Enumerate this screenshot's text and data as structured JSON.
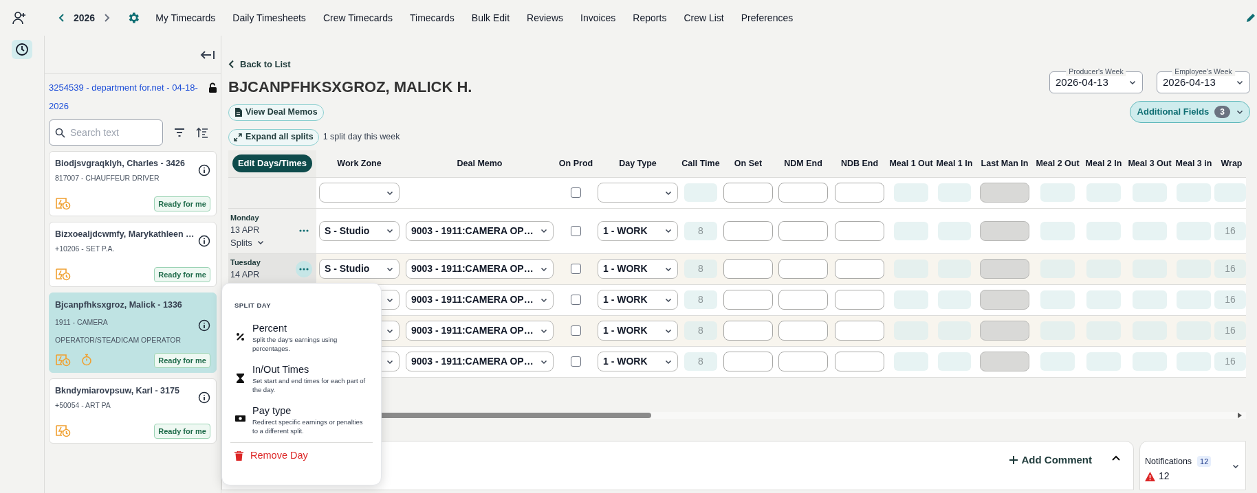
{
  "top_nav": {
    "year": "2026",
    "items": [
      "My Timecards",
      "Daily Timesheets",
      "Crew Timecards",
      "Timecards",
      "Bulk Edit",
      "Reviews",
      "Invoices",
      "Reports",
      "Crew List",
      "Preferences"
    ]
  },
  "employee_panel": {
    "batch_link": "3254539 - department for.net - 04-18-2026",
    "search": {
      "placeholder": "Search text"
    },
    "cards": [
      {
        "name": "Biodjsvgraqklyh, Charles - 3426",
        "lines": [
          "817007 - CHAUFFEUR DRIVER"
        ],
        "status": "Ready for me",
        "selected": false,
        "timer": false
      },
      {
        "name": "Bizxoealjdcwmfy, Marykathleen …",
        "lines": [
          "+10206 - SET P.A."
        ],
        "status": "Ready for me",
        "selected": false,
        "timer": false
      },
      {
        "name": "Bjcanpfhksxgroz, Malick - 1336",
        "lines": [
          "1911 - CAMERA",
          "OPERATOR/STEADICAM OPERATOR"
        ],
        "status": "Ready for me",
        "selected": true,
        "timer": true
      },
      {
        "name": "Bkndymiarovpsuw, Karl - 3175",
        "lines": [
          "+50054 - ART PA"
        ],
        "status": "Ready for me",
        "selected": false,
        "timer": false
      }
    ]
  },
  "timecard": {
    "back": "Back to List",
    "title": "BJCANPFHKSXGROZ, MALICK H.",
    "view_deal_memos": "View Deal Memos",
    "expand_splits": "Expand all splits",
    "split_note": "1 split day this week",
    "producers_week": {
      "label": "Producer's Week",
      "value": "2026-04-13"
    },
    "employees_week": {
      "label": "Employee's Week",
      "value": "2026-04-13"
    },
    "additional_fields": {
      "label": "Additional Fields",
      "count": "3"
    }
  },
  "table": {
    "edit_button": "Edit Days/Times",
    "columns": [
      "Work Zone",
      "Deal Memo",
      "On Prod",
      "Day Type",
      "Call Time",
      "On Set",
      "NDM End",
      "NDB End",
      "Meal 1 Out",
      "Meal 1 In",
      "Last Man In",
      "Meal 2 Out",
      "Meal 2 In",
      "Meal 3 Out",
      "Meal 3 in",
      "Wrap"
    ],
    "rows": [
      {
        "kind": "filter",
        "on_prod": false
      },
      {
        "kind": "day",
        "day": "Monday",
        "date": "13 APR",
        "splits": "Splits",
        "work_zone": "S - Studio",
        "deal_memo": "9003 - 1911:CAMERA OP…",
        "on_prod": false,
        "day_type": "1 - WORK",
        "call_time": "8",
        "wrap": "16",
        "shaded": false,
        "menu_open": false
      },
      {
        "kind": "day",
        "day": "Tuesday",
        "date": "14 APR",
        "work_zone": "S - Studio",
        "deal_memo": "9003 - 1911:CAMERA OP…",
        "on_prod": false,
        "day_type": "1 - WORK",
        "call_time": "8",
        "wrap": "16",
        "shaded": true,
        "menu_open": true
      },
      {
        "kind": "day",
        "deal_memo": "9003 - 1911:CAMERA OP…",
        "on_prod": false,
        "day_type": "1 - WORK",
        "call_time": "8",
        "wrap": "16",
        "shaded": false
      },
      {
        "kind": "day",
        "deal_memo": "9003 - 1911:CAMERA OP…",
        "on_prod": false,
        "day_type": "1 - WORK",
        "call_time": "8",
        "wrap": "16",
        "shaded": true
      },
      {
        "kind": "day",
        "deal_memo": "9003 - 1911:CAMERA OP…",
        "on_prod": false,
        "day_type": "1 - WORK",
        "call_time": "8",
        "wrap": "16",
        "shaded": false
      }
    ]
  },
  "split_menu": {
    "title": "SPLIT DAY",
    "options": [
      {
        "kind": "percent",
        "label": "Percent",
        "description": "Split the day's earnings using percentages."
      },
      {
        "kind": "times",
        "label": "In/Out Times",
        "description": "Set start and end times for each part of the day."
      },
      {
        "kind": "paytype",
        "label": "Pay type",
        "description": "Redirect specific earnings or penalties to a different split."
      }
    ],
    "remove": "Remove Day"
  },
  "comments": {
    "add": "Add Comment"
  },
  "notifications": {
    "label": "Notifications",
    "count": "12",
    "warnings": "12"
  }
}
